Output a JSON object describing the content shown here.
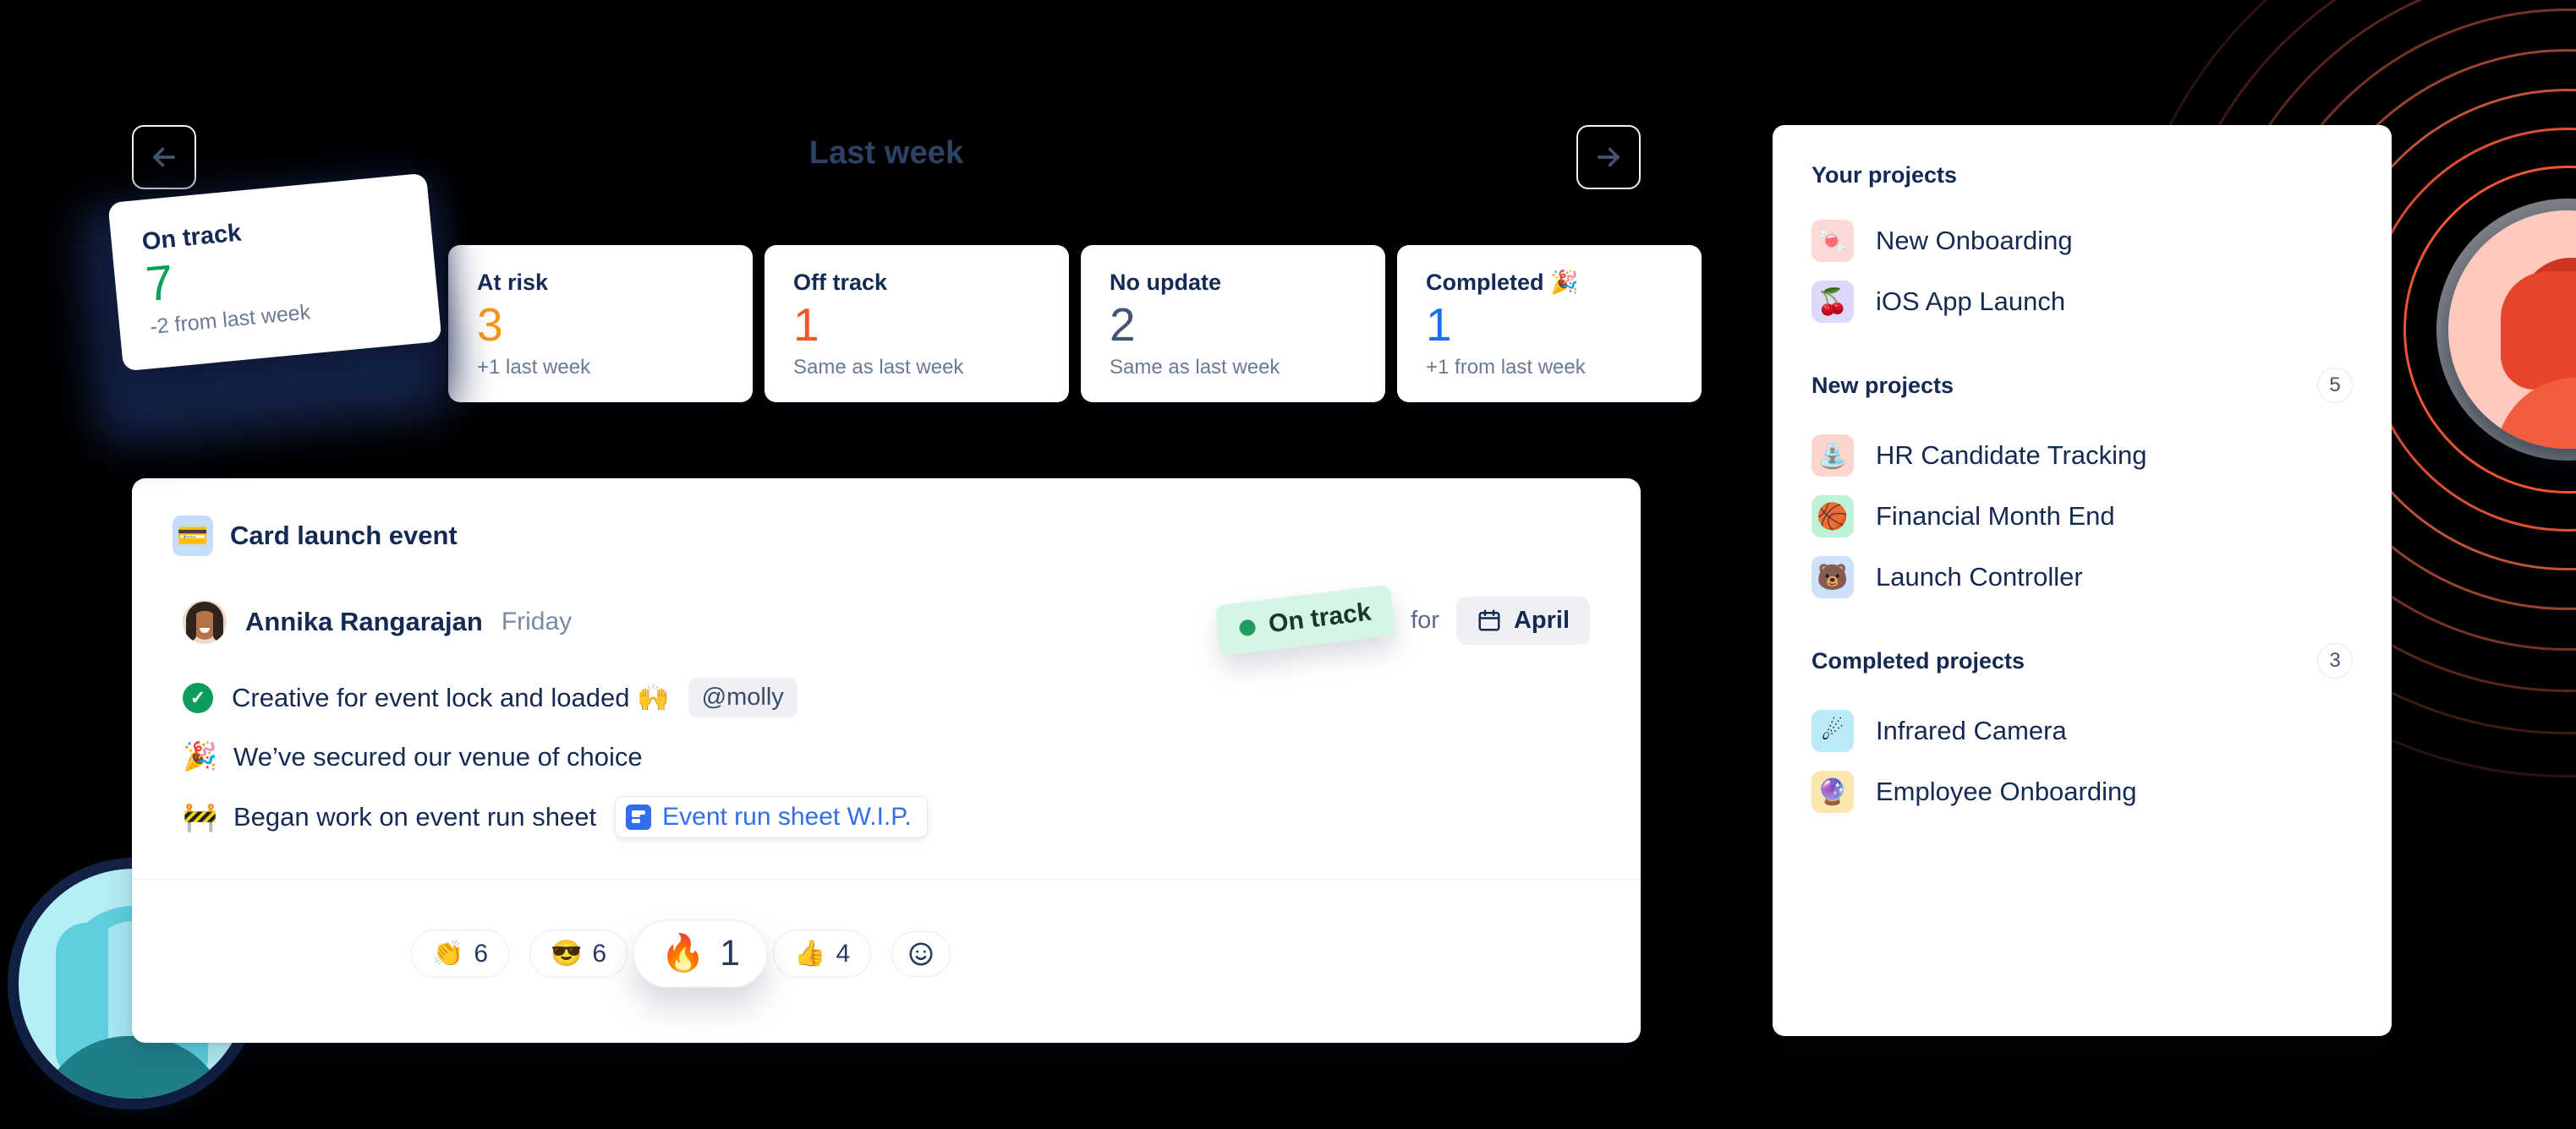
{
  "header": {
    "week_title": "Last week",
    "prev_icon": "arrow-left-icon",
    "next_icon": "arrow-right-icon"
  },
  "status_cards": [
    {
      "label": "On track",
      "value": "7",
      "delta": "-2 from last week",
      "color": "#0aa05a",
      "floating": true
    },
    {
      "label": "At risk",
      "value": "3",
      "delta": "+1 last week",
      "color": "#f59516"
    },
    {
      "label": "Off track",
      "value": "1",
      "delta": "Same as last week",
      "color": "#fa5426"
    },
    {
      "label": "No update",
      "value": "2",
      "delta": "Same as last week",
      "color": "#44546f"
    },
    {
      "label": "Completed 🎉",
      "value": "1",
      "delta": "+1 from last week",
      "color": "#1b6ef3"
    }
  ],
  "feed": {
    "project_emoji": "💳",
    "project_title": "Card launch event",
    "author_name": "Annika Rangarajan",
    "author_day": "Friday",
    "status_label": "On track",
    "status_color": "#1f9d62",
    "status_for": "for",
    "month_icon": "calendar-icon",
    "month_label": "April",
    "bullets": [
      {
        "icon": "check-circle-icon",
        "emoji": "",
        "text": "Creative for event lock and loaded 🙌",
        "mention": "@molly"
      },
      {
        "icon": "emoji",
        "emoji": "🎉",
        "text": "We’ve secured our venue of choice",
        "mention": ""
      },
      {
        "icon": "emoji",
        "emoji": "🚧",
        "text": "Began work on event run sheet",
        "doc": "Event run sheet W.I.P."
      }
    ],
    "reactions": [
      {
        "emoji": "👏",
        "count": "6",
        "highlight": false
      },
      {
        "emoji": "😎",
        "count": "6",
        "highlight": false
      },
      {
        "emoji": "🔥",
        "count": "1",
        "highlight": true
      },
      {
        "emoji": "👍",
        "count": "4",
        "highlight": false
      },
      {
        "emoji": "☺",
        "count": "",
        "highlight": false,
        "add": true
      }
    ]
  },
  "sidebar": {
    "sections": [
      {
        "title": "Your projects",
        "count": "",
        "items": [
          {
            "emoji": "🍬",
            "label": "New Onboarding",
            "tile_color": "#fcd9d6"
          },
          {
            "emoji": "🍒",
            "label": "iOS App Launch",
            "tile_color": "#ded9fb"
          }
        ]
      },
      {
        "title": "New projects",
        "count": "5",
        "items": [
          {
            "emoji": "⛲",
            "label": "HR Candidate Tracking",
            "tile_color": "#fbd5ce"
          },
          {
            "emoji": "🏀",
            "label": "Financial Month End",
            "tile_color": "#bdf2d7"
          },
          {
            "emoji": "🐻",
            "label": "Launch Controller",
            "tile_color": "#cfe0fb"
          }
        ]
      },
      {
        "title": "Completed projects",
        "count": "3",
        "items": [
          {
            "emoji": "☄",
            "label": "Infrared Camera",
            "tile_color": "#bbeaf7"
          },
          {
            "emoji": "🔮",
            "label": "Employee Onboarding",
            "tile_color": "#fbe6b0"
          }
        ]
      }
    ]
  },
  "decor": {
    "ring_avatar": "woman-profile-avatar",
    "corner_avatar": "woman-avatar"
  }
}
